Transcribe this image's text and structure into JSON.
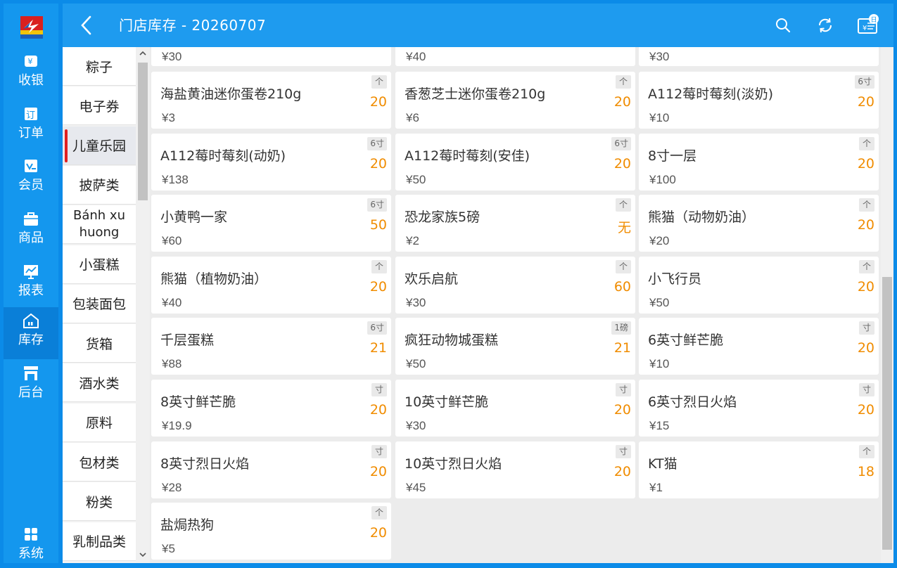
{
  "header": {
    "title": "门店库存 - 20260707"
  },
  "nav": [
    {
      "label": "收银",
      "icon": "cashier-icon"
    },
    {
      "label": "订单",
      "icon": "order-icon"
    },
    {
      "label": "会员",
      "icon": "member-icon"
    },
    {
      "label": "商品",
      "icon": "goods-bag-icon"
    },
    {
      "label": "报表",
      "icon": "report-chart-icon"
    },
    {
      "label": "库存",
      "icon": "warehouse-home-icon",
      "active": true
    },
    {
      "label": "后台",
      "icon": "store-icon"
    },
    {
      "label": "系统",
      "icon": "grid-apps-icon"
    }
  ],
  "categories": [
    {
      "label": "粽子"
    },
    {
      "label": "电子券"
    },
    {
      "label": "儿童乐园",
      "active": true
    },
    {
      "label": "披萨类"
    },
    {
      "label": "Bánh xu huong"
    },
    {
      "label": "小蛋糕"
    },
    {
      "label": "包装面包"
    },
    {
      "label": "货箱"
    },
    {
      "label": "酒水类"
    },
    {
      "label": "原料"
    },
    {
      "label": "包材类"
    },
    {
      "label": "粉类"
    },
    {
      "label": "乳制品类"
    }
  ],
  "partial_row": [
    {
      "price": "¥30"
    },
    {
      "price": "¥40"
    },
    {
      "price": "¥30"
    }
  ],
  "products": [
    {
      "name": "海盐黄油迷你蛋卷210g",
      "unit": "个",
      "stock": "20",
      "price": "¥3"
    },
    {
      "name": "香葱芝士迷你蛋卷210g",
      "unit": "个",
      "stock": "20",
      "price": "¥6"
    },
    {
      "name": "A112莓时莓刻(淡奶)",
      "unit": "6寸",
      "stock": "20",
      "price": "¥10"
    },
    {
      "name": "A112莓时莓刻(动奶)",
      "unit": "6寸",
      "stock": "20",
      "price": "¥138"
    },
    {
      "name": "A112莓时莓刻(安佳)",
      "unit": "6寸",
      "stock": "20",
      "price": "¥50"
    },
    {
      "name": "8寸一层",
      "unit": "个",
      "stock": "20",
      "price": "¥100"
    },
    {
      "name": "小黄鸭一家",
      "unit": "6寸",
      "stock": "50",
      "price": "¥60"
    },
    {
      "name": "恐龙家族5磅",
      "unit": "个",
      "stock": "无",
      "price": "¥2"
    },
    {
      "name": "熊猫（动物奶油）",
      "unit": "个",
      "stock": "20",
      "price": "¥20"
    },
    {
      "name": "熊猫（植物奶油）",
      "unit": "个",
      "stock": "20",
      "price": "¥40"
    },
    {
      "name": "欢乐启航",
      "unit": "个",
      "stock": "60",
      "price": "¥30"
    },
    {
      "name": "小飞行员",
      "unit": "个",
      "stock": "20",
      "price": "¥50"
    },
    {
      "name": "千层蛋糕",
      "unit": "6寸",
      "stock": "21",
      "price": "¥88"
    },
    {
      "name": "疯狂动物城蛋糕",
      "unit": "1磅",
      "stock": "21",
      "price": "¥50"
    },
    {
      "name": "6英寸鲜芒脆",
      "unit": "寸",
      "stock": "20",
      "price": "¥10"
    },
    {
      "name": "8英寸鲜芒脆",
      "unit": "寸",
      "stock": "20",
      "price": "¥19.9"
    },
    {
      "name": "10英寸鲜芒脆",
      "unit": "寸",
      "stock": "20",
      "price": "¥30"
    },
    {
      "name": "6英寸烈日火焰",
      "unit": "寸",
      "stock": "20",
      "price": "¥15"
    },
    {
      "name": "8英寸烈日火焰",
      "unit": "寸",
      "stock": "20",
      "price": "¥28"
    },
    {
      "name": "10英寸烈日火焰",
      "unit": "寸",
      "stock": "20",
      "price": "¥45"
    },
    {
      "name": "KT猫",
      "unit": "个",
      "stock": "18",
      "price": "¥1"
    },
    {
      "name": "盐焗热狗",
      "unit": "个",
      "stock": "20",
      "price": "¥5"
    }
  ],
  "colors": {
    "header": "#1e9bef",
    "rail": "#1497ee",
    "stock": "#f08c00",
    "active_marker": "#e02020"
  }
}
